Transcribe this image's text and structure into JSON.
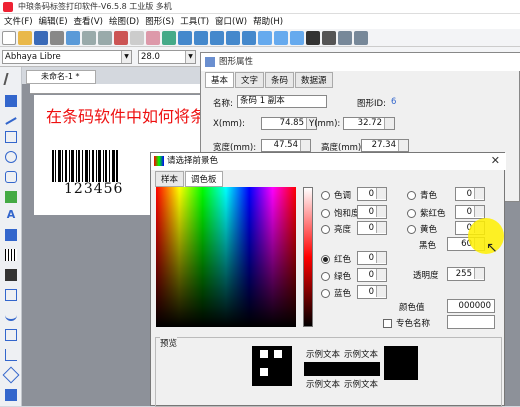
{
  "app": {
    "title": "中琅条码标签打印软件-V6.5.8 工业版 多机"
  },
  "menu": [
    "文件(F)",
    "编辑(E)",
    "查看(V)",
    "绘图(D)",
    "图形(S)",
    "工具(T)",
    "窗口(W)",
    "帮助(H)"
  ],
  "toolbar2": {
    "font": "Abhaya Libre",
    "size": "28.0"
  },
  "doc": {
    "tab": "未命名-1 *",
    "canvas_text": "在条码软件中如何将条",
    "barcode_number": "123456"
  },
  "props": {
    "title": "图形属性",
    "tabs": [
      "基本",
      "文字",
      "条码",
      "数据源"
    ],
    "name_label": "名称:",
    "name_value": "条码 1 副本",
    "id_label": "图形ID:",
    "id_value": "6",
    "x_label": "X(mm):",
    "x_value": "74.85",
    "y_label": "Y(mm):",
    "y_value": "32.72",
    "w_label": "宽度(mm):",
    "w_value": "47.54",
    "h_label": "高度(mm):",
    "h_value": "27.34"
  },
  "color_dialog": {
    "title": "请选择前景色",
    "tabs": [
      "样本",
      "调色板"
    ],
    "hsv": [
      {
        "label": "色调",
        "value": "0"
      },
      {
        "label": "饱和度",
        "value": "0"
      },
      {
        "label": "亮度",
        "value": "0"
      }
    ],
    "rgb": [
      {
        "label": "红色",
        "value": "0"
      },
      {
        "label": "绿色",
        "value": "0"
      },
      {
        "label": "蓝色",
        "value": "0"
      }
    ],
    "cmyk": [
      {
        "label": "青色",
        "value": "0"
      },
      {
        "label": "紫红色",
        "value": "0"
      },
      {
        "label": "黄色",
        "value": "0"
      },
      {
        "label": "黑色",
        "value": "60"
      }
    ],
    "opacity_label": "透明度",
    "opacity_value": "255",
    "colorvalue_label": "颜色值",
    "colorvalue_value": "000000",
    "named_label": "专色名称",
    "preview_label": "预览",
    "sample_text": "示例文本"
  }
}
